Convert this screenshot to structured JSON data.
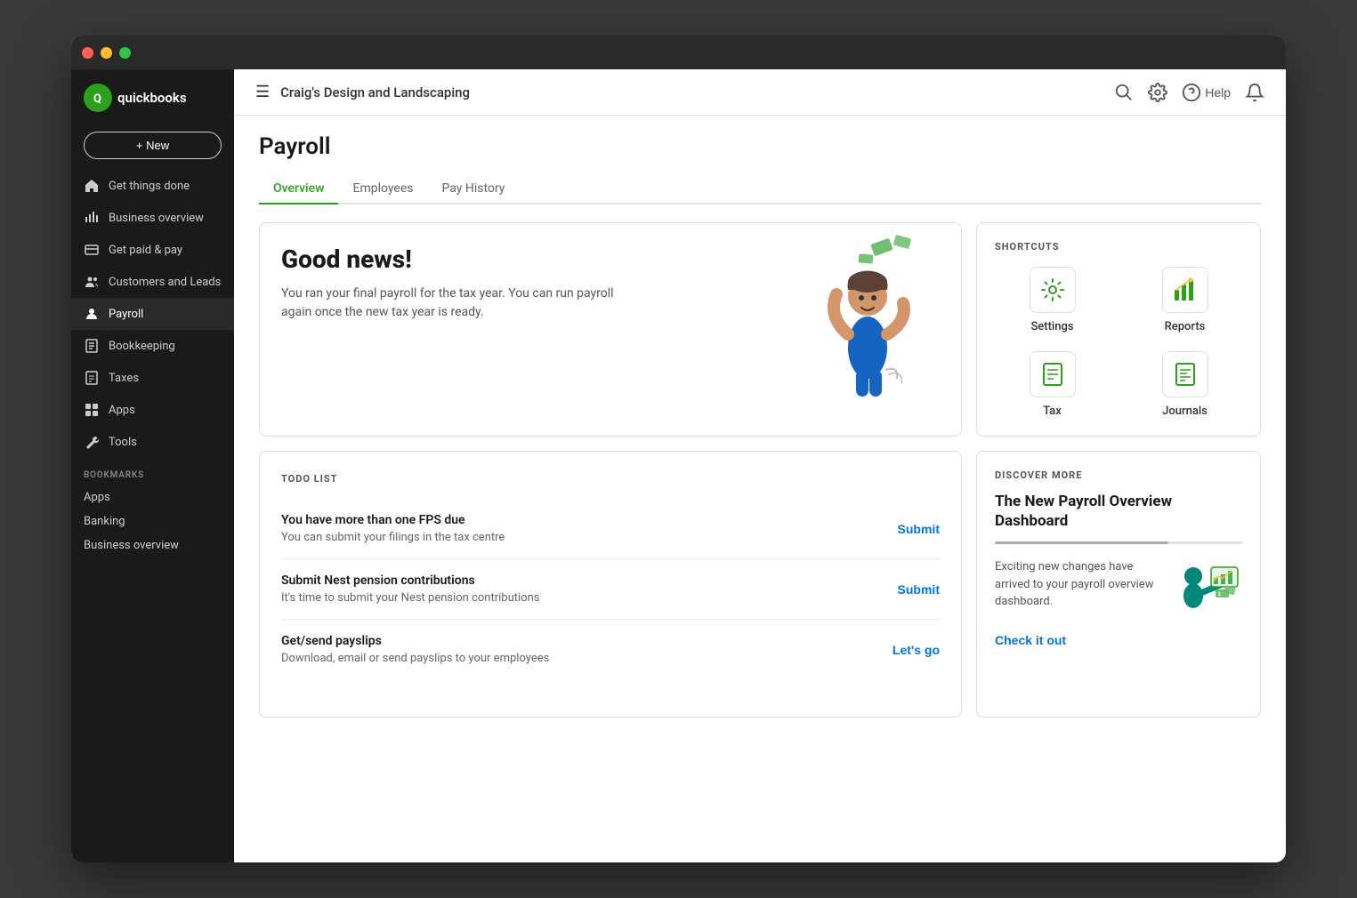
{
  "window": {
    "title": "QuickBooks"
  },
  "header": {
    "menu_icon": "☰",
    "company_name": "Craig's Design and Landscaping",
    "search_label": "Search",
    "help_label": "Help"
  },
  "sidebar": {
    "logo_text": "quickbooks",
    "new_button": "+ New",
    "nav_items": [
      {
        "id": "get-things-done",
        "label": "Get things done",
        "icon": "🏠"
      },
      {
        "id": "business-overview",
        "label": "Business overview",
        "icon": "📈"
      },
      {
        "id": "get-paid-pay",
        "label": "Get paid & pay",
        "icon": "💳"
      },
      {
        "id": "customers-leads",
        "label": "Customers and Leads",
        "icon": "👥"
      },
      {
        "id": "payroll",
        "label": "Payroll",
        "icon": "👤",
        "active": true
      },
      {
        "id": "bookkeeping",
        "label": "Bookkeeping",
        "icon": "📋"
      },
      {
        "id": "taxes",
        "label": "Taxes",
        "icon": "🗂"
      },
      {
        "id": "apps",
        "label": "Apps",
        "icon": "⊞"
      },
      {
        "id": "tools",
        "label": "Tools",
        "icon": "🔧"
      }
    ],
    "bookmarks_label": "BOOKMARKS",
    "bookmarks": [
      {
        "id": "apps",
        "label": "Apps"
      },
      {
        "id": "banking",
        "label": "Banking"
      },
      {
        "id": "business-overview",
        "label": "Business overview"
      }
    ]
  },
  "page": {
    "title": "Payroll",
    "tabs": [
      {
        "id": "overview",
        "label": "Overview",
        "active": true
      },
      {
        "id": "employees",
        "label": "Employees",
        "active": false
      },
      {
        "id": "pay-history",
        "label": "Pay History",
        "active": false
      }
    ]
  },
  "good_news": {
    "heading": "Good news!",
    "body": "You ran your final payroll for the tax year. You can run payroll again once the new tax year is ready."
  },
  "shortcuts": {
    "title": "SHORTCUTS",
    "items": [
      {
        "id": "settings",
        "label": "Settings"
      },
      {
        "id": "reports",
        "label": "Reports"
      },
      {
        "id": "tax",
        "label": "Tax"
      },
      {
        "id": "journals",
        "label": "Journals"
      }
    ]
  },
  "todo": {
    "title": "TODO LIST",
    "items": [
      {
        "id": "fps-due",
        "heading": "You have more than one FPS due",
        "body": "You can submit your filings in the tax centre",
        "action_label": "Submit"
      },
      {
        "id": "nest-pension",
        "heading": "Submit Nest pension contributions",
        "body": "It's time to submit your Nest pension contributions",
        "action_label": "Submit"
      },
      {
        "id": "payslips",
        "heading": "Get/send payslips",
        "body": "Download, email or send payslips to your employees",
        "action_label": "Let's go"
      }
    ]
  },
  "discover": {
    "title": "DISCOVER MORE",
    "heading": "The New Payroll Overview Dashboard",
    "body": "Exciting new changes have arrived to your payroll overview dashboard.",
    "action_label": "Check it out"
  }
}
